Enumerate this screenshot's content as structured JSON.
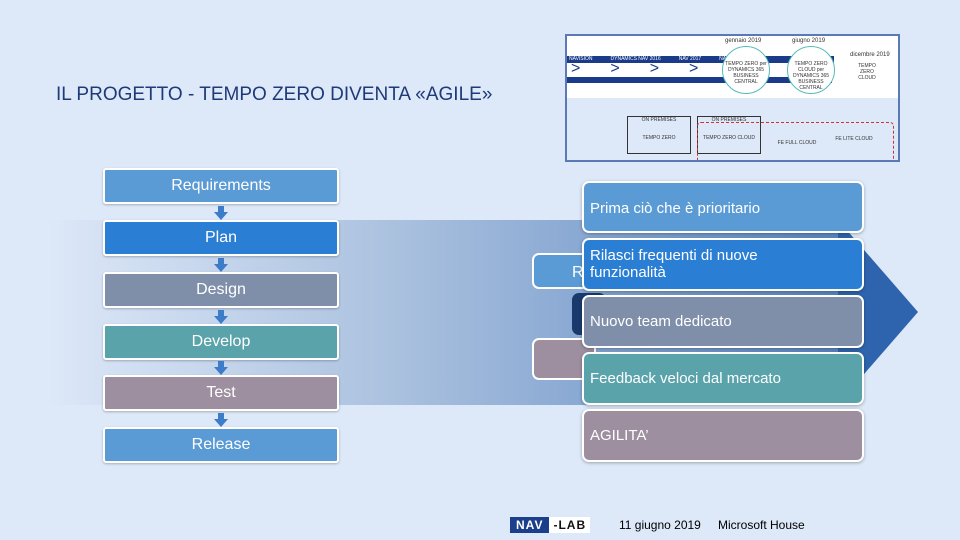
{
  "title": "IL PROGETTO -  TEMPO ZERO DIVENTA «AGILE»",
  "process_steps": [
    {
      "label": "Requirements",
      "color": "#5b9bd5"
    },
    {
      "label": "Plan",
      "color": "#2a7fd4"
    },
    {
      "label": "Design",
      "color": "#7f8faa"
    },
    {
      "label": "Develop",
      "color": "#5aa3ab"
    },
    {
      "label": "Test",
      "color": "#9d8fa0"
    },
    {
      "label": "Release",
      "color": "#5b9bd5"
    }
  ],
  "agile_points": [
    {
      "label": "Prima ciò che è prioritario",
      "color": "#5b9bd5"
    },
    {
      "label": "Rilasci frequenti di nuove funzionalità",
      "color": "#2a7fd4"
    },
    {
      "label": "Nuovo team dedicato",
      "color": "#7f8faa"
    },
    {
      "label": "Feedback veloci dal mercato",
      "color": "#5aa3ab"
    },
    {
      "label": "AGILITA’",
      "color": "#9d8fa0"
    }
  ],
  "hidden_letter": "R",
  "roadmap_image": {
    "dates": [
      "gennaio 2019",
      "giugno 2019",
      "dicembre 2019"
    ],
    "top_row": [
      "NAVISION",
      "DYNAMICS NAV 2016",
      "NAV 2017",
      "NAV 2018"
    ],
    "milestones": [
      "TEMPO ZERO per DYNAMICS 365 BUSINESS CENTRAL",
      "TEMPO ZERO CLOUD per DYNAMICS 365 BUSINESS CENTRAL",
      "TEMPO ZERO CLOUD"
    ],
    "products": [
      {
        "tag": "ON PREMISES",
        "name": "TEMPO ZERO"
      },
      {
        "tag": "ON PREMISES",
        "name": "TEMPO ZERO CLOUD"
      },
      {
        "tag": "",
        "name": "FE FULL CLOUD"
      },
      {
        "tag": "",
        "name": "FE LITE CLOUD"
      }
    ]
  },
  "footer": {
    "logo_left": "NAV",
    "logo_right": "-LAB",
    "date": "11 giugno 2019",
    "venue": "Microsoft House"
  }
}
